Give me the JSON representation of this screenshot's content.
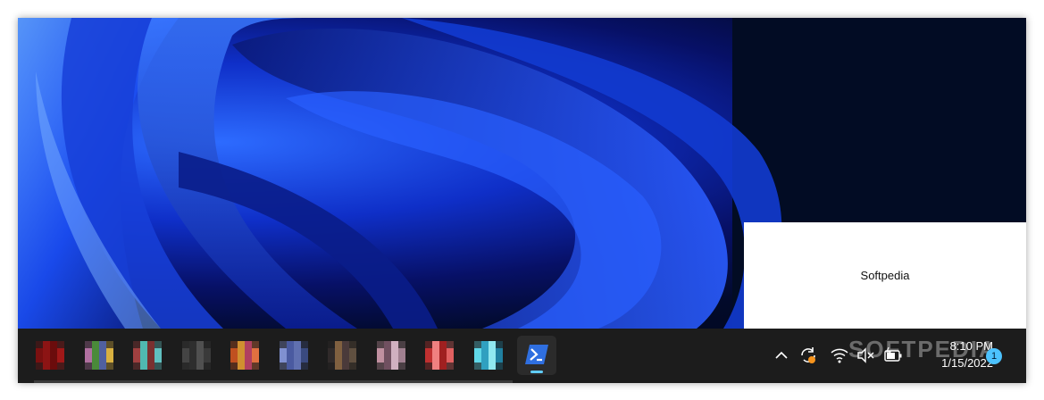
{
  "popup": {
    "text": "Softpedia"
  },
  "taskbar": {
    "apps": [
      {
        "name": "app-1",
        "colors": [
          "#7a1010",
          "#a01818",
          "#6b0c0c",
          "#8c1414"
        ]
      },
      {
        "name": "app-2",
        "colors": [
          "#4a8a3a",
          "#b070a0",
          "#d8b040",
          "#5060a0"
        ]
      },
      {
        "name": "app-3",
        "colors": [
          "#7a3030",
          "#50b8b0",
          "#a04040",
          "#60c0c0"
        ]
      },
      {
        "name": "app-4",
        "colors": [
          "#3a3a3a",
          "#505050",
          "#2e2e2e",
          "#444444"
        ]
      },
      {
        "name": "app-5",
        "colors": [
          "#c05020",
          "#e07040",
          "#b04060",
          "#d09030"
        ]
      },
      {
        "name": "app-6",
        "colors": [
          "#4a5aa0",
          "#8090d0",
          "#3a4a80",
          "#6070b0"
        ]
      },
      {
        "name": "app-7",
        "colors": [
          "#4a3a3a",
          "#806040",
          "#302a2a",
          "#605040"
        ]
      },
      {
        "name": "app-8",
        "colors": [
          "#a08090",
          "#d0b0c0",
          "#705060",
          "#c090a0"
        ]
      },
      {
        "name": "app-9",
        "colors": [
          "#c03030",
          "#e06060",
          "#a02020",
          "#f08080"
        ]
      },
      {
        "name": "app-10",
        "colors": [
          "#30a0c0",
          "#60d8e8",
          "#2080a0",
          "#90e8f0"
        ]
      }
    ],
    "active_app": "powershell"
  },
  "tray": {
    "time": "8:10 PM",
    "date": "1/15/2022",
    "notification_count": "1",
    "icons": [
      "chevron-up-icon",
      "sync-icon",
      "wifi-icon",
      "volume-muted-icon",
      "battery-icon"
    ]
  },
  "watermark": "SOFTPEDIA",
  "colors": {
    "taskbar_bg": "#1c1c1c",
    "accent": "#60cdff",
    "badge": "#4cc2ff"
  }
}
